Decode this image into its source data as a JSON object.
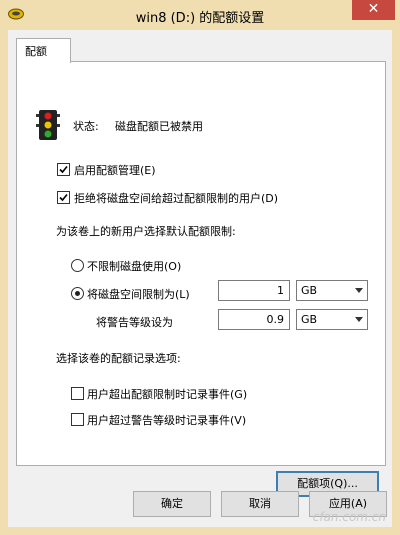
{
  "window": {
    "title": "win8 (D:) 的配额设置",
    "close_glyph": "✕"
  },
  "tabs": [
    {
      "label": "配额"
    }
  ],
  "status": {
    "label": "状态:",
    "value": "磁盘配额已被禁用"
  },
  "options": {
    "enable_quota": "启用配额管理(E)",
    "deny_space": "拒绝将磁盘空间给超过配额限制的用户(D)"
  },
  "default_limit": {
    "heading": "为该卷上的新用户选择默认配额限制:",
    "no_limit": "不限制磁盘使用(O)",
    "limit_to": "将磁盘空间限制为(L)",
    "limit_value": "1",
    "limit_unit": "GB",
    "warning_label": "将警告等级设为",
    "warning_value": "0.9",
    "warning_unit": "GB"
  },
  "logging": {
    "heading": "选择该卷的配额记录选项:",
    "log_over_limit": "用户超出配额限制时记录事件(G)",
    "log_over_warning": "用户超过警告等级时记录事件(V)"
  },
  "buttons": {
    "quota_entries": "配额项(Q)...",
    "ok": "确定",
    "cancel": "取消",
    "apply": "应用(A)"
  },
  "watermark": "cfan.com.cn"
}
